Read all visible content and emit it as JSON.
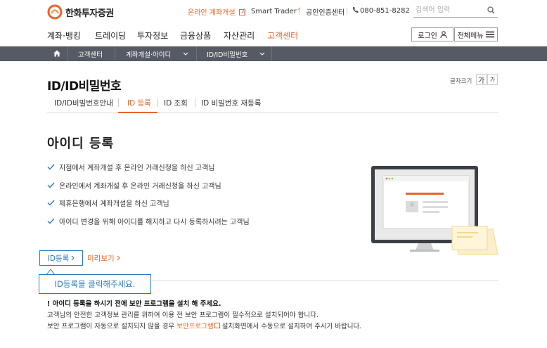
{
  "header": {
    "logo_text": "한화투자증권",
    "open_account": "온라인 계좌개설",
    "smart_trader": "Smart Trader",
    "cert_center": "공인인증센터",
    "phone": "080-851-8282",
    "search_placeholder": "검색어 입력",
    "brand_color": "#e8642b"
  },
  "gnb": {
    "items": [
      {
        "label": "계좌·뱅킹"
      },
      {
        "label": "트레이딩"
      },
      {
        "label": "투자정보"
      },
      {
        "label": "금융상품"
      },
      {
        "label": "자산관리"
      },
      {
        "label": "고객센터",
        "active": true
      }
    ],
    "login_label": "로그인",
    "all_menu_label": "전체메뉴"
  },
  "breadcrumb": {
    "items": [
      "고객센터",
      "계좌개설·아이디",
      "ID/ID비밀번호"
    ]
  },
  "page": {
    "title": "ID/ID비밀번호",
    "font_size_label": "글자크기",
    "font_btn_large": "가",
    "font_btn_small": "가"
  },
  "tabs": [
    {
      "label": "ID/ID비밀번호안내"
    },
    {
      "label": "ID 등록",
      "active": true
    },
    {
      "label": "ID 조회"
    },
    {
      "label": "ID 비밀번호 재등록"
    }
  ],
  "content": {
    "section_title": "아이디 등록",
    "checklist": [
      "지점에서 계좌개설 후 온라인 거래신청을 하신 고객님",
      "온라인에서 계좌개설 후 온라인 거래신청을 하신 고객님",
      "제휴은행에서 계좌개설을 하신 고객님",
      "아이디 변경을 위해 아이디를 해지하고 다시 등록하시려는 고객님"
    ],
    "id_register_button": "ID등록",
    "preview_link": "미리보기",
    "tooltip": "ID등록을 클릭해주세요."
  },
  "notice": {
    "title": "! 아이디 등록을 하시기 전에 보안 프로그램을 설치 해 주세요.",
    "line1": "고객님의 안전한 고객정보 관리를 위하여 이용 전 보안 프로그램이 필수적으로 설치되어야 합니다.",
    "line2_before": "보안 프로그램이 자동으로 설치되지 않을 경우 ",
    "line2_link": "보안프로그램",
    "line2_after": " 설치화면에서 수동으로 설치하여 주시기 바랍니다."
  }
}
